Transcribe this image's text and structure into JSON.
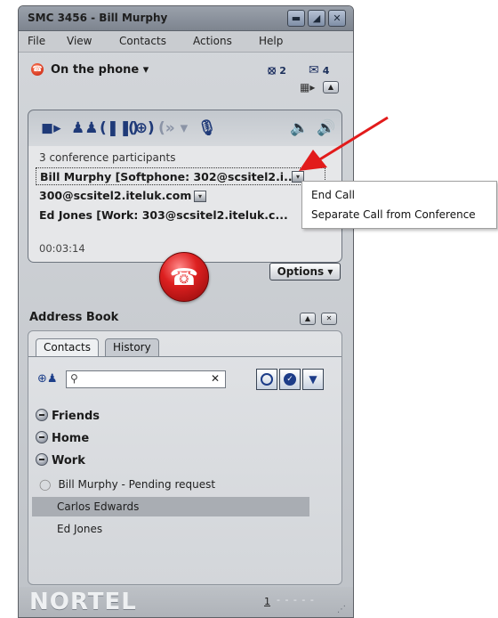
{
  "window": {
    "title": "SMC 3456 - Bill Murphy",
    "controls": [
      "minimize-icon",
      "restore-icon",
      "close-icon"
    ]
  },
  "menu": [
    "File",
    "View",
    "Contacts",
    "Actions",
    "Help"
  ],
  "status": {
    "label": "On the phone ▾",
    "missed_calls": "2",
    "messages": "4"
  },
  "call": {
    "controls": [
      "video-icon",
      "conference-icon",
      "hold-icon",
      "add-participant-icon",
      "transfer-icon",
      "microphone-icon",
      "volume-down-icon",
      "volume-up-icon"
    ],
    "participants_count": "3 conference participants",
    "participants": [
      "Bill Murphy [Softphone: 302@scsitel2.i...",
      "300@scsitel2.iteluk.com",
      "Ed Jones [Work: 303@scsitel2.iteluk.c..."
    ],
    "timer": "00:03:14",
    "options_label": "Options"
  },
  "context_menu": {
    "items": [
      "End Call",
      "Separate Call from Conference"
    ]
  },
  "address_book": {
    "title": "Address Book",
    "tabs": [
      "Contacts",
      "History"
    ],
    "search": {
      "value": "",
      "placeholder": ""
    },
    "groups": [
      "Friends",
      "Home",
      "Work"
    ],
    "contacts": [
      "Bill Murphy - Pending request",
      "Carlos Edwards",
      "Ed Jones"
    ],
    "selected_contact": "Carlos Edwards"
  },
  "footer": {
    "brand": "NORTEL",
    "line_indicator": "1"
  },
  "colors": {
    "window_bg": "#c9ccd0",
    "call_icons": "#1f3a78",
    "hangup": "#dd2020",
    "arrow": "#e21b1b",
    "selected_row": "#a9adb3"
  }
}
